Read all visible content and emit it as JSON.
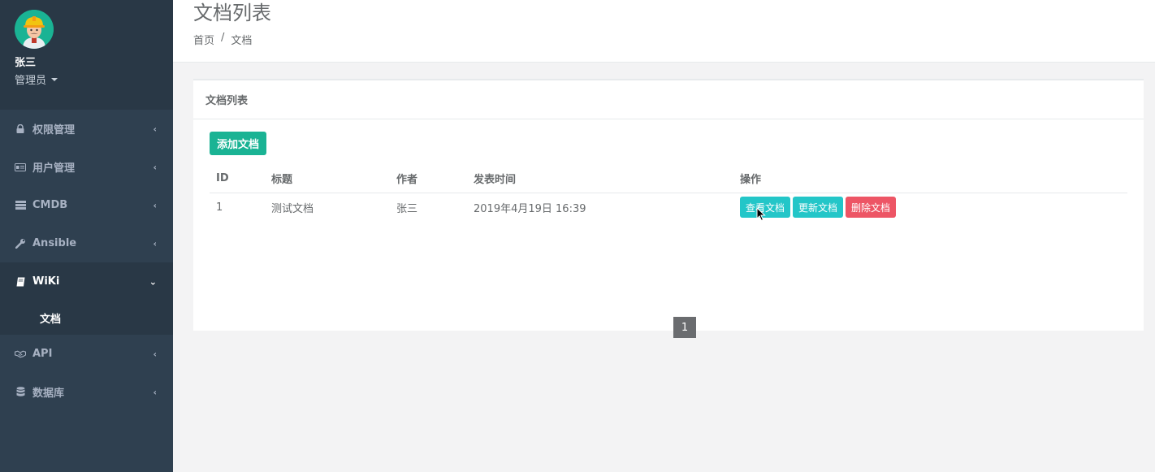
{
  "profile": {
    "name": "张三",
    "role": "管理员"
  },
  "sidebar": {
    "items": [
      {
        "label": "权限管理",
        "icon": "lock-icon"
      },
      {
        "label": "用户管理",
        "icon": "id-card-icon"
      },
      {
        "label": "CMDB",
        "icon": "server-icon"
      },
      {
        "label": "Ansible",
        "icon": "wrench-icon"
      },
      {
        "label": "WiKi",
        "icon": "book-icon",
        "active": true,
        "children": [
          {
            "label": "文档"
          }
        ]
      },
      {
        "label": "API",
        "icon": "handshake-icon"
      },
      {
        "label": "数据库",
        "icon": "database-icon"
      }
    ]
  },
  "header": {
    "title": "文档列表",
    "breadcrumb": [
      "首页",
      "/",
      "文档"
    ]
  },
  "panel": {
    "title": "文档列表",
    "add_button": "添加文档",
    "table": {
      "columns": [
        "ID",
        "标题",
        "作者",
        "发表时间",
        "操作"
      ],
      "rows": [
        {
          "id": "1",
          "title": "测试文档",
          "author": "张三",
          "time": "2019年4月19日 16:39",
          "actions": [
            "查看文档",
            "更新文档",
            "删除文档"
          ]
        }
      ]
    },
    "pagination": {
      "current": "1"
    }
  },
  "colors": {
    "sidebar_bg": "#2f4050",
    "primary": "#1ab394",
    "info": "#23c6c8",
    "danger": "#ed5565"
  }
}
